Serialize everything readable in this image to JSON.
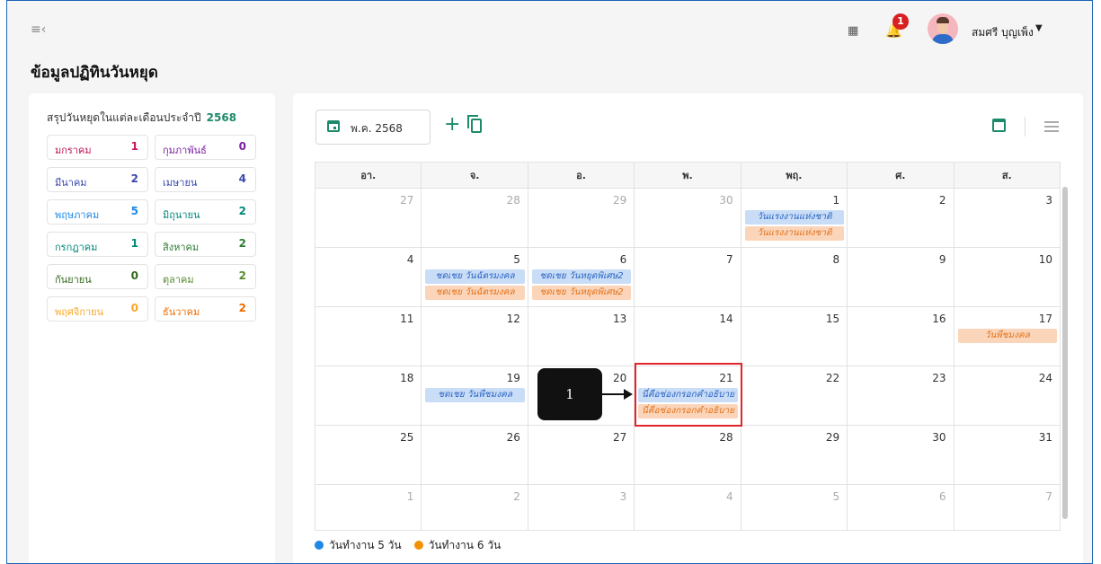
{
  "header": {
    "user_name": "สมศรี บุญเพ็ง",
    "notification_count": "1",
    "page_title": "ข้อมูลปฏิทินวันหยุด"
  },
  "summary": {
    "title": "สรุปวันหยุดในแต่ละเดือนประจำปี",
    "year": "2568",
    "months": [
      {
        "name": "มกราคม",
        "count": "1",
        "color": "#c2185b"
      },
      {
        "name": "กุมภาพันธ์",
        "count": "0",
        "color": "#7b1fa2"
      },
      {
        "name": "มีนาคม",
        "count": "2",
        "color": "#3949ab"
      },
      {
        "name": "เมษายน",
        "count": "4",
        "color": "#3949ab"
      },
      {
        "name": "พฤษภาคม",
        "count": "5",
        "color": "#1e88e5"
      },
      {
        "name": "มิถุนายน",
        "count": "2",
        "color": "#00897b"
      },
      {
        "name": "กรกฎาคม",
        "count": "1",
        "color": "#00897b"
      },
      {
        "name": "สิงหาคม",
        "count": "2",
        "color": "#2e7d32"
      },
      {
        "name": "กันยายน",
        "count": "0",
        "color": "#33691e"
      },
      {
        "name": "ตุลาคม",
        "count": "2",
        "color": "#558b2f"
      },
      {
        "name": "พฤศจิกายน",
        "count": "0",
        "color": "#f9a825"
      },
      {
        "name": "ธันวาคม",
        "count": "2",
        "color": "#ef6c00"
      }
    ]
  },
  "toolbar": {
    "month_label": "พ.ค. 2568",
    "add_symbol": "+"
  },
  "calendar": {
    "weekdays": [
      "อา.",
      "จ.",
      "อ.",
      "พ.",
      "พฤ.",
      "ศ.",
      "ส."
    ],
    "weeks": [
      [
        {
          "day": "27",
          "other": true,
          "events": []
        },
        {
          "day": "28",
          "other": true,
          "events": []
        },
        {
          "day": "29",
          "other": true,
          "events": []
        },
        {
          "day": "30",
          "other": true,
          "events": []
        },
        {
          "day": "1",
          "other": false,
          "events": [
            {
              "label": "วันแรงงานแห่งชาติ",
              "type": "blue"
            },
            {
              "label": "วันแรงงานแห่งชาติ",
              "type": "orange"
            }
          ]
        },
        {
          "day": "2",
          "other": false,
          "events": []
        },
        {
          "day": "3",
          "other": false,
          "events": []
        }
      ],
      [
        {
          "day": "4",
          "other": false,
          "events": []
        },
        {
          "day": "5",
          "other": false,
          "events": [
            {
              "label": "ชดเชย วันฉัตรมงคล",
              "type": "blue"
            },
            {
              "label": "ชดเชย วันฉัตรมงคล",
              "type": "orange"
            }
          ]
        },
        {
          "day": "6",
          "other": false,
          "events": [
            {
              "label": "ชดเชย วันหยุดพิเศษ2",
              "type": "blue"
            },
            {
              "label": "ชดเชย วันหยุดพิเศษ2",
              "type": "orange"
            }
          ]
        },
        {
          "day": "7",
          "other": false,
          "events": []
        },
        {
          "day": "8",
          "other": false,
          "events": []
        },
        {
          "day": "9",
          "other": false,
          "events": []
        },
        {
          "day": "10",
          "other": false,
          "events": []
        }
      ],
      [
        {
          "day": "11",
          "other": false,
          "events": []
        },
        {
          "day": "12",
          "other": false,
          "events": []
        },
        {
          "day": "13",
          "other": false,
          "events": []
        },
        {
          "day": "14",
          "other": false,
          "events": []
        },
        {
          "day": "15",
          "other": false,
          "events": []
        },
        {
          "day": "16",
          "other": false,
          "events": []
        },
        {
          "day": "17",
          "other": false,
          "events": [
            {
              "label": "วันพืชมงคล",
              "type": "orange"
            }
          ]
        }
      ],
      [
        {
          "day": "18",
          "other": false,
          "events": []
        },
        {
          "day": "19",
          "other": false,
          "events": [
            {
              "label": "ชดเชย วันพืชมงคล",
              "type": "blue"
            }
          ]
        },
        {
          "day": "20",
          "other": false,
          "events": []
        },
        {
          "day": "21",
          "other": false,
          "events": [
            {
              "label": "นี่คือช่องกรอกคำอธิบาย",
              "type": "blue"
            },
            {
              "label": "นี่คือช่องกรอกคำอธิบาย",
              "type": "orange"
            }
          ]
        },
        {
          "day": "22",
          "other": false,
          "events": []
        },
        {
          "day": "23",
          "other": false,
          "events": []
        },
        {
          "day": "24",
          "other": false,
          "events": []
        }
      ],
      [
        {
          "day": "25",
          "other": false,
          "events": []
        },
        {
          "day": "26",
          "other": false,
          "events": []
        },
        {
          "day": "27",
          "other": false,
          "events": []
        },
        {
          "day": "28",
          "other": false,
          "events": []
        },
        {
          "day": "29",
          "other": false,
          "events": []
        },
        {
          "day": "30",
          "other": false,
          "events": []
        },
        {
          "day": "31",
          "other": false,
          "events": []
        }
      ],
      [
        {
          "day": "1",
          "other": true,
          "events": []
        },
        {
          "day": "2",
          "other": true,
          "events": []
        },
        {
          "day": "3",
          "other": true,
          "events": []
        },
        {
          "day": "4",
          "other": true,
          "events": []
        },
        {
          "day": "5",
          "other": true,
          "events": []
        },
        {
          "day": "6",
          "other": true,
          "events": []
        },
        {
          "day": "7",
          "other": true,
          "events": []
        }
      ]
    ]
  },
  "legend": [
    {
      "label": "วันทำงาน 5 วัน",
      "color": "#1e88e5"
    },
    {
      "label": "วันทำงาน 6 วัน",
      "color": "#f39200"
    }
  ],
  "callout": {
    "number": "1"
  },
  "colors": {
    "accent": "#1d8a6b",
    "highlight": "#e0262b"
  },
  "icons": [
    "menu-collapse-icon",
    "book-icon",
    "bell-icon",
    "calendar-icon",
    "plus-icon",
    "copy-icon",
    "calendar-view-icon",
    "list-view-icon",
    "caret-down-icon"
  ]
}
